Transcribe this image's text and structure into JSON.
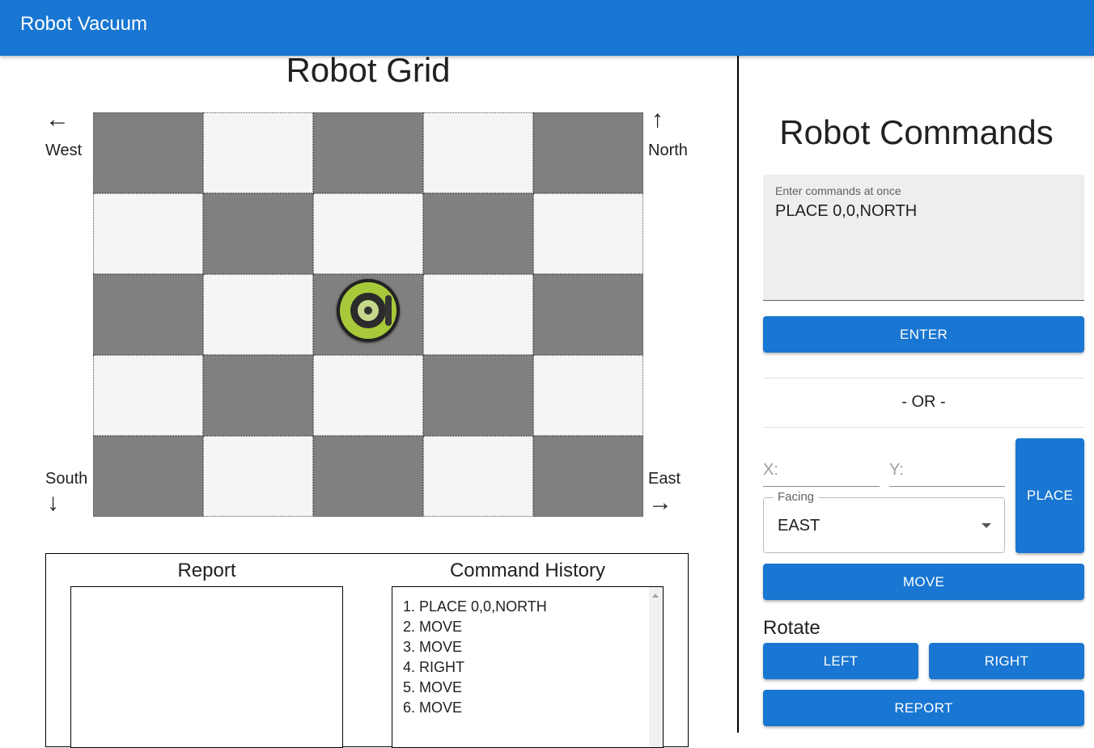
{
  "appbar": {
    "title": "Robot Vacuum"
  },
  "grid": {
    "title": "Robot Grid",
    "rows": 5,
    "cols": 5,
    "robot": {
      "row": 2,
      "col": 2
    },
    "directions": {
      "west": "West",
      "north": "North",
      "south": "South",
      "east": "East"
    },
    "arrows": {
      "west": "←",
      "north": "↑",
      "south": "↓",
      "east": "→"
    }
  },
  "report": {
    "title": "Report",
    "text": ""
  },
  "history": {
    "title": "Command History",
    "items": [
      "1. PLACE 0,0,NORTH",
      "2. MOVE",
      "3. MOVE",
      "4. RIGHT",
      "5. MOVE",
      "6. MOVE"
    ]
  },
  "commands": {
    "title": "Robot Commands",
    "textarea": {
      "label": "Enter commands at once",
      "value": "PLACE 0,0,NORTH"
    },
    "enter_label": "ENTER",
    "or_text": "- OR -",
    "x_label": "X:",
    "y_label": "Y:",
    "facing": {
      "label": "Facing",
      "value": "EAST"
    },
    "place_label": "PLACE",
    "move_label": "MOVE",
    "rotate_label": "Rotate",
    "left_label": "LEFT",
    "right_label": "RIGHT",
    "report_label": "REPORT"
  },
  "colors": {
    "primary": "#1976d2",
    "dark_cell": "#808080",
    "light_cell": "#f5f5f5"
  }
}
